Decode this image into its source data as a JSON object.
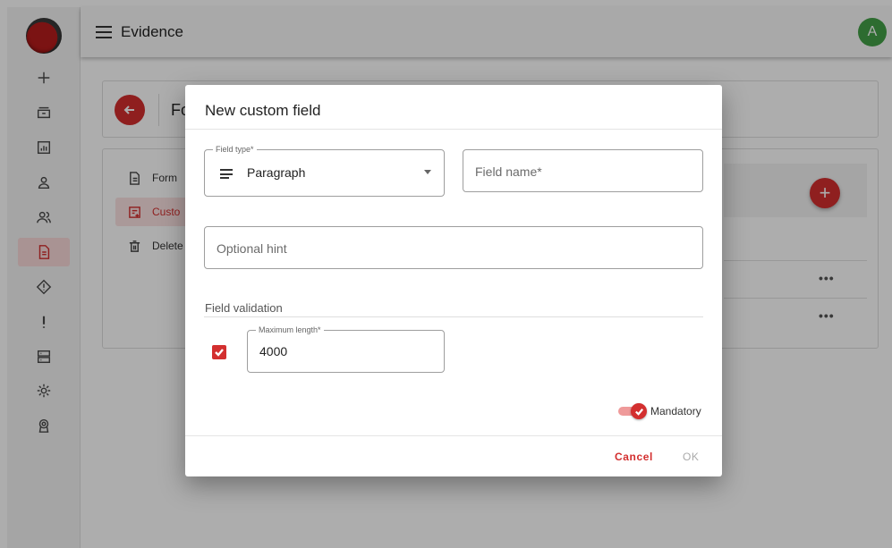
{
  "app": {
    "title": "Evidence",
    "avatar_initial": "A",
    "accent_color": "#d32f2f",
    "avatar_color": "#43a047"
  },
  "sidebar": {
    "items": [
      {
        "icon": "plus-icon"
      },
      {
        "icon": "archive-icon"
      },
      {
        "icon": "chart-icon"
      },
      {
        "icon": "user-icon"
      },
      {
        "icon": "users-icon"
      },
      {
        "icon": "document-icon",
        "active": true
      },
      {
        "icon": "warning-diamond-icon"
      },
      {
        "icon": "exclamation-icon"
      },
      {
        "icon": "server-icon"
      },
      {
        "icon": "settings-icon"
      },
      {
        "icon": "award-icon"
      }
    ]
  },
  "page": {
    "header_title": "Fo",
    "nav": [
      {
        "label": "Form",
        "icon": "file-icon"
      },
      {
        "label": "Custo",
        "icon": "custom-fields-icon",
        "active": true
      },
      {
        "label": "Delete",
        "icon": "trash-icon"
      }
    ],
    "row_action": "•••"
  },
  "dialog": {
    "title": "New custom field",
    "field_type": {
      "legend": "Field type*",
      "value": "Paragraph",
      "icon": "paragraph-lines-icon"
    },
    "field_name": {
      "placeholder": "Field name*"
    },
    "hint": {
      "placeholder": "Optional hint"
    },
    "validation": {
      "section_label": "Field validation",
      "max_length_enabled": true,
      "max_length": {
        "legend": "Maximum length*",
        "value": "4000"
      }
    },
    "mandatory": {
      "label": "Mandatory",
      "checked": true
    },
    "actions": {
      "cancel": "Cancel",
      "ok": "OK"
    }
  }
}
